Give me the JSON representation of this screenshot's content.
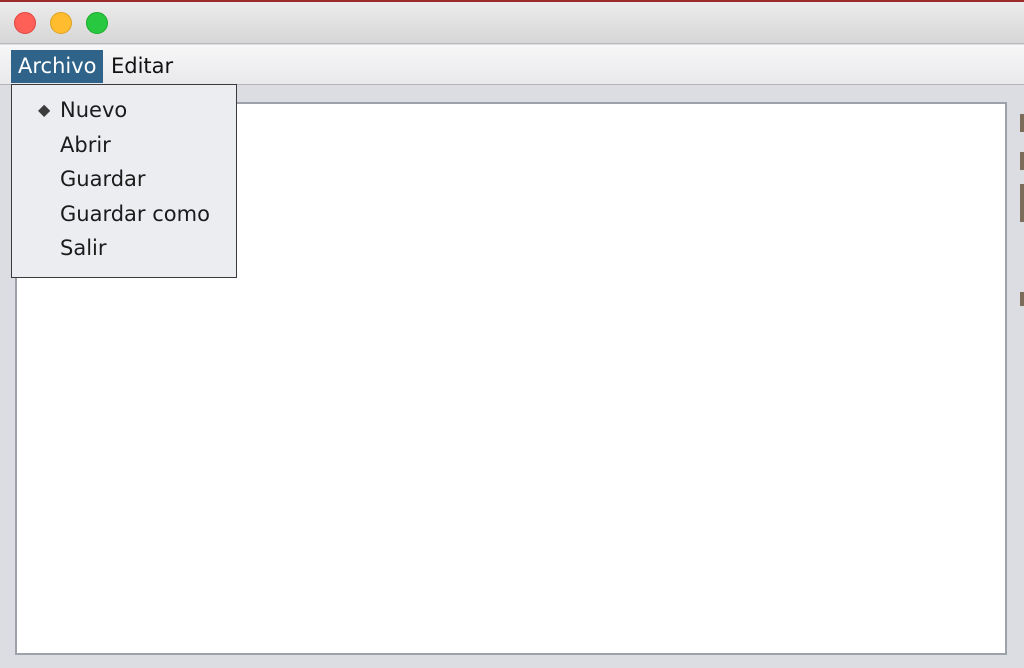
{
  "window": {
    "controls": [
      "close-button",
      "minimize-button",
      "maximize-button"
    ]
  },
  "menubar": {
    "archivo": "Archivo",
    "editar": "Editar"
  },
  "dropdown": {
    "selected_marker": "◆",
    "items": [
      {
        "label": "Nuevo"
      },
      {
        "label": "Abrir"
      },
      {
        "label": "Guardar"
      },
      {
        "label": "Guardar como"
      },
      {
        "label": "Salir"
      }
    ]
  },
  "colors": {
    "menu_highlight": "#2f6389",
    "close": "#fe5f57",
    "minimize": "#febc2e",
    "maximize": "#28c840"
  }
}
